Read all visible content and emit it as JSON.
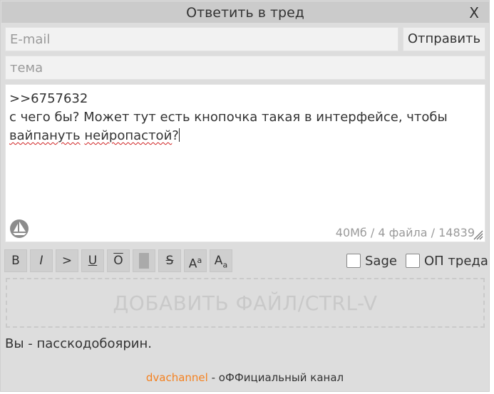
{
  "window": {
    "title": "Ответить в тред",
    "close_label": "X"
  },
  "form": {
    "email_placeholder": "E-mail",
    "send_label": "Отправить",
    "subject_placeholder": "тема",
    "message": {
      "line1": ">>6757632",
      "line2": "с чего бы? Может тут есть кнопочка такая в интерфейсе, чтобы",
      "word1": "вайпануть",
      "space": " ",
      "word2": "нейропастой",
      "punct": "?"
    },
    "counter": "40Мб / 4 файла / 14839"
  },
  "toolbar": {
    "bold": "B",
    "italic": "I",
    "quote": ">",
    "underline": "U",
    "overline": "O",
    "spoiler": "",
    "strike": "S",
    "sup_main": "A",
    "sup_small": "a",
    "sub_main": "A",
    "sub_small": "a"
  },
  "options": {
    "sage_label": "Sage",
    "op_label": "ОП треда"
  },
  "dropzone_label": "ДОБАВИТЬ ФАЙЛ/CTRL-V",
  "status_text": "Вы - пасскодобоярин.",
  "footer": {
    "link_text": "dvachannel",
    "suffix": " - оФФициальный канал"
  },
  "colors": {
    "panel_bg": "#dddddd",
    "accent_link": "#f48120"
  }
}
